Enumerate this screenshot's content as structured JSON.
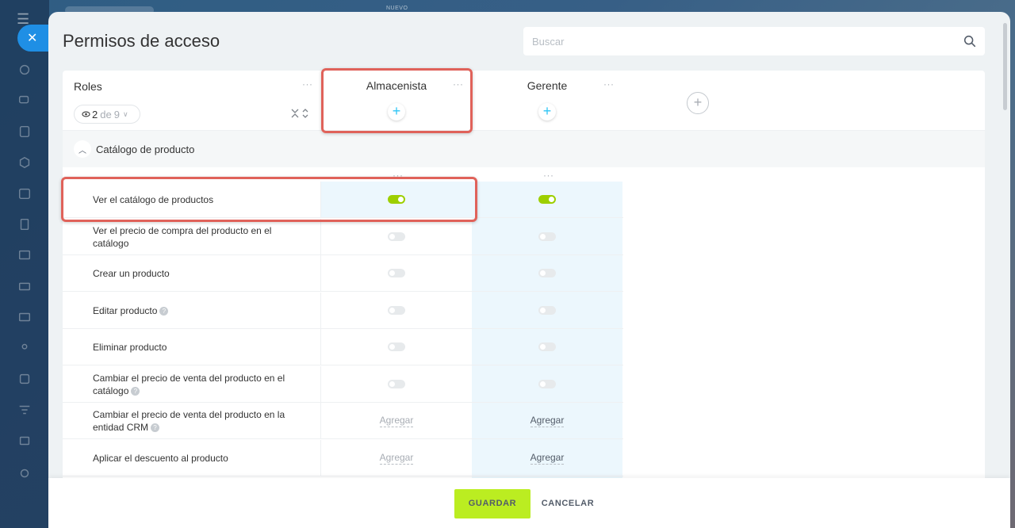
{
  "background": {
    "new_label": "NUEVO"
  },
  "panel": {
    "title": "Permisos de acceso",
    "search_placeholder": "Buscar"
  },
  "header": {
    "roles_label": "Roles",
    "visible_count": "2",
    "of_label": "de",
    "total_count": "9",
    "roles": [
      {
        "name": "Almacenista"
      },
      {
        "name": "Gerente"
      }
    ]
  },
  "section": {
    "title": "Catálogo de producto"
  },
  "permissions": [
    {
      "label": "Ver el catálogo de productos",
      "help": false,
      "values": [
        "on",
        "on"
      ]
    },
    {
      "label": "Ver el precio de compra del producto en el catálogo",
      "help": false,
      "values": [
        "off",
        "off"
      ]
    },
    {
      "label": "Crear un producto",
      "help": false,
      "values": [
        "off",
        "off"
      ]
    },
    {
      "label": "Editar producto",
      "help": true,
      "values": [
        "off",
        "off"
      ]
    },
    {
      "label": "Eliminar producto",
      "help": false,
      "values": [
        "off",
        "off"
      ]
    },
    {
      "label": "Cambiar el precio de venta del producto en el catálogo",
      "help": true,
      "values": [
        "off",
        "off"
      ]
    },
    {
      "label": "Cambiar el precio de venta del producto en la entidad CRM",
      "help": true,
      "values": [
        "Agregar",
        "Agregar"
      ]
    },
    {
      "label": "Aplicar el descuento al producto",
      "help": false,
      "values": [
        "Agregar",
        "Agregar"
      ]
    }
  ],
  "footer": {
    "save_label": "GUARDAR",
    "cancel_label": "CANCELAR"
  },
  "colors": {
    "accent_blue": "#2fc6f6",
    "toggle_on": "#9dcf00",
    "save_button": "#bbed21",
    "annotation": "#e0625a",
    "column_highlight": "#ecf7fd"
  }
}
